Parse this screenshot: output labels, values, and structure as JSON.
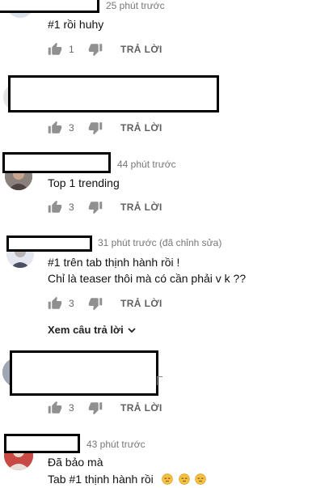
{
  "comments": [
    {
      "time": "25 phút trước",
      "lines": [
        "#1 rồi huhy"
      ],
      "likes": "1",
      "reply_label": "TRẢ LỜI"
    },
    {
      "time": "",
      "lines": [],
      "likes": "3",
      "reply_label": "TRẢ LỜI"
    },
    {
      "time": "44 phút trước",
      "lines": [
        "Top 1 trending"
      ],
      "likes": "3",
      "reply_label": "TRẢ LỜI"
    },
    {
      "time": "31 phút trước (đã chỉnh sửa)",
      "lines": [
        "#1 trên tab thịnh hành rồi !",
        "Chỉ là teaser thôi mà có cần phải v k ??"
      ],
      "likes": "3",
      "reply_label": "TRẢ LỜI",
      "view_replies": "Xem câu trả lời"
    },
    {
      "time": "",
      "lines": [],
      "likes": "3",
      "reply_label": "TRẢ LỜI"
    },
    {
      "time": "43 phút trước",
      "lines": [
        "Đã bảo mà",
        "Tab #1 thịnh hành rồi"
      ],
      "emojis": [
        "pensive-emoji",
        "pensive-emoji",
        "pensive-emoji"
      ]
    }
  ],
  "colors": {
    "text": "#111111",
    "meta": "#777777",
    "icon": "#909090",
    "redaction": "#000000"
  },
  "icons": {
    "like": "thumbs-up-icon",
    "dislike": "thumbs-down-icon",
    "expand": "chevron-down-icon"
  }
}
